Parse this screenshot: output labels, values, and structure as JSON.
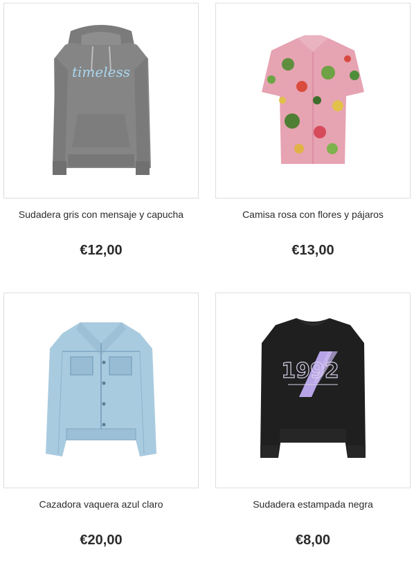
{
  "products": [
    {
      "name": "Sudadera gris con mensaje y capucha",
      "price": "€12,00",
      "image_icon": "grey-hoodie-image",
      "print_text": "timeless"
    },
    {
      "name": "Camisa rosa con flores y pájaros",
      "price": "€13,00",
      "image_icon": "pink-floral-shirt-image"
    },
    {
      "name": "Cazadora vaquera azul claro",
      "price": "€20,00",
      "image_icon": "light-denim-jacket-image"
    },
    {
      "name": "Sudadera estampada negra",
      "price": "€8,00",
      "image_icon": "black-printed-sweatshirt-image",
      "print_text": "1992"
    }
  ]
}
